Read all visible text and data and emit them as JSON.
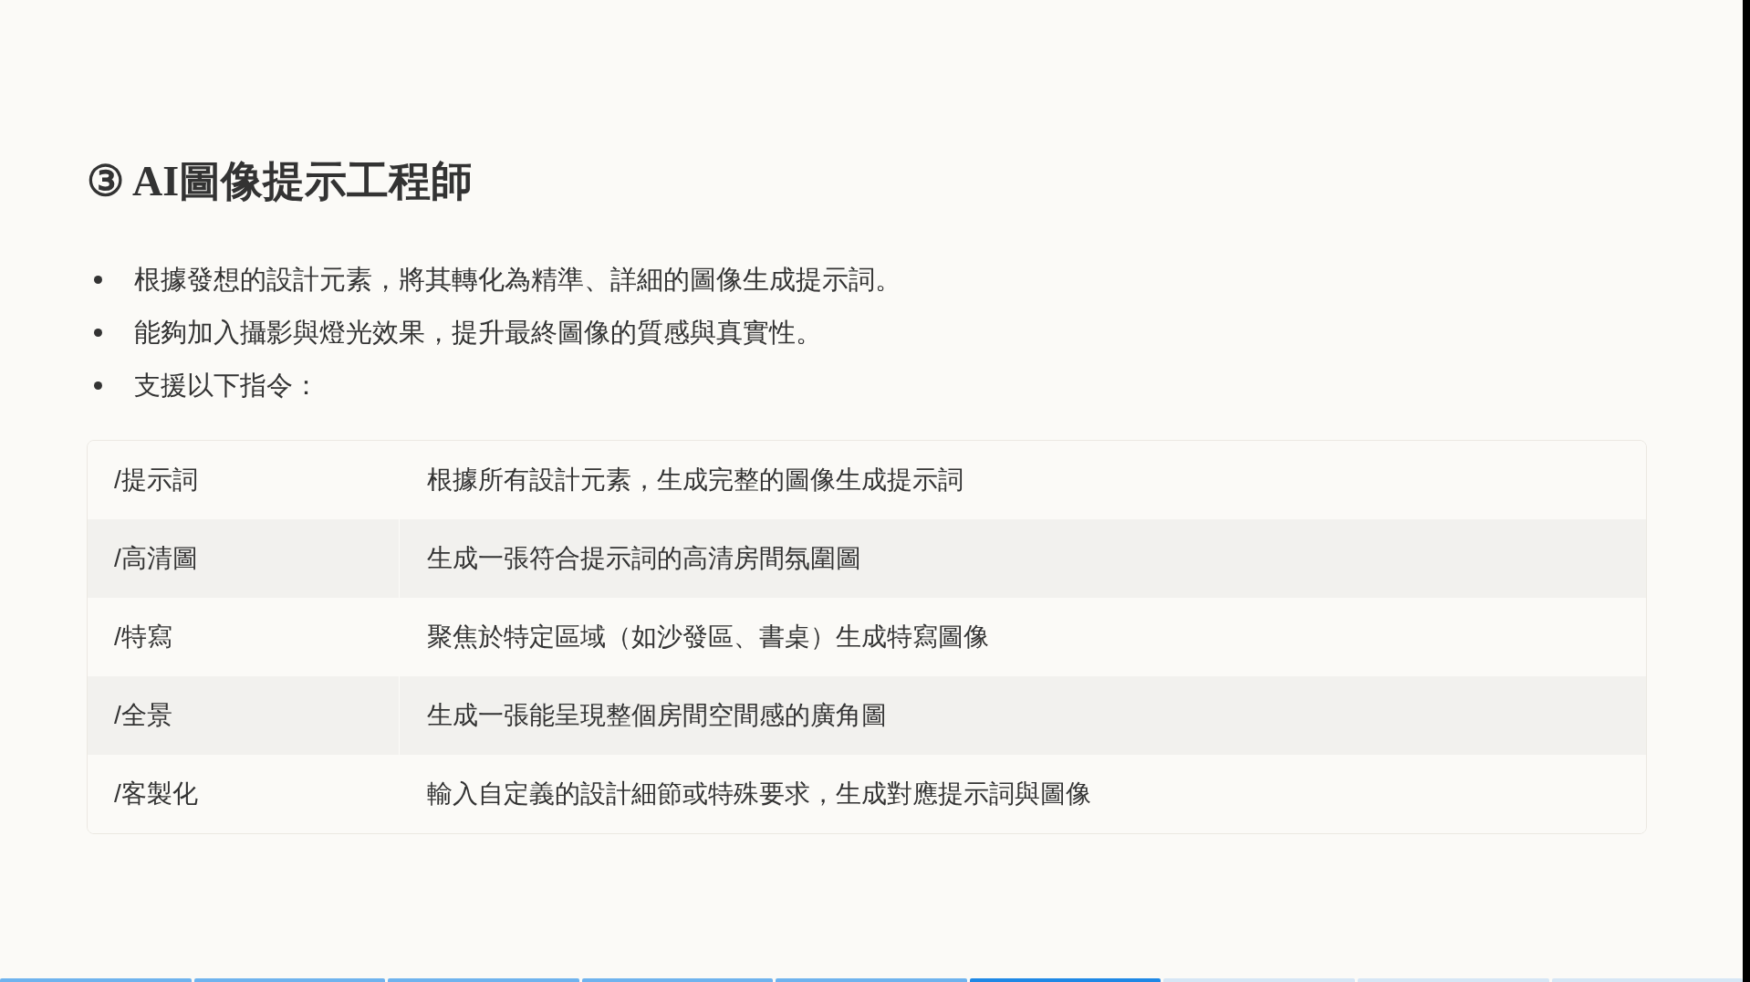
{
  "slide": {
    "title": "③ AI圖像提示工程師",
    "bullets": [
      "根據發想的設計元素，將其轉化為精準、詳細的圖像生成提示詞。",
      "能夠加入攝影與燈光效果，提升最終圖像的質感與真實性。",
      "支援以下指令："
    ],
    "table": {
      "rows": [
        {
          "command": "/提示詞",
          "description": "根據所有設計元素，生成完整的圖像生成提示詞"
        },
        {
          "command": "/高清圖",
          "description": "生成一張符合提示詞的高清房間氛圍圖"
        },
        {
          "command": "/特寫",
          "description": "聚焦於特定區域（如沙發區、書桌）生成特寫圖像"
        },
        {
          "command": "/全景",
          "description": "生成一張能呈現整個房間空間感的廣角圖"
        },
        {
          "command": "/客製化",
          "description": "輸入自定義的設計細節或特殊要求，生成對應提示詞與圖像"
        }
      ]
    }
  },
  "progress": [
    {
      "visited": true,
      "selected": false
    },
    {
      "visited": true,
      "selected": false
    },
    {
      "visited": true,
      "selected": false
    },
    {
      "visited": true,
      "selected": false
    },
    {
      "visited": true,
      "selected": false
    },
    {
      "visited": true,
      "selected": true
    },
    {
      "visited": false,
      "selected": false
    },
    {
      "visited": false,
      "selected": false
    },
    {
      "visited": false,
      "selected": false
    }
  ]
}
